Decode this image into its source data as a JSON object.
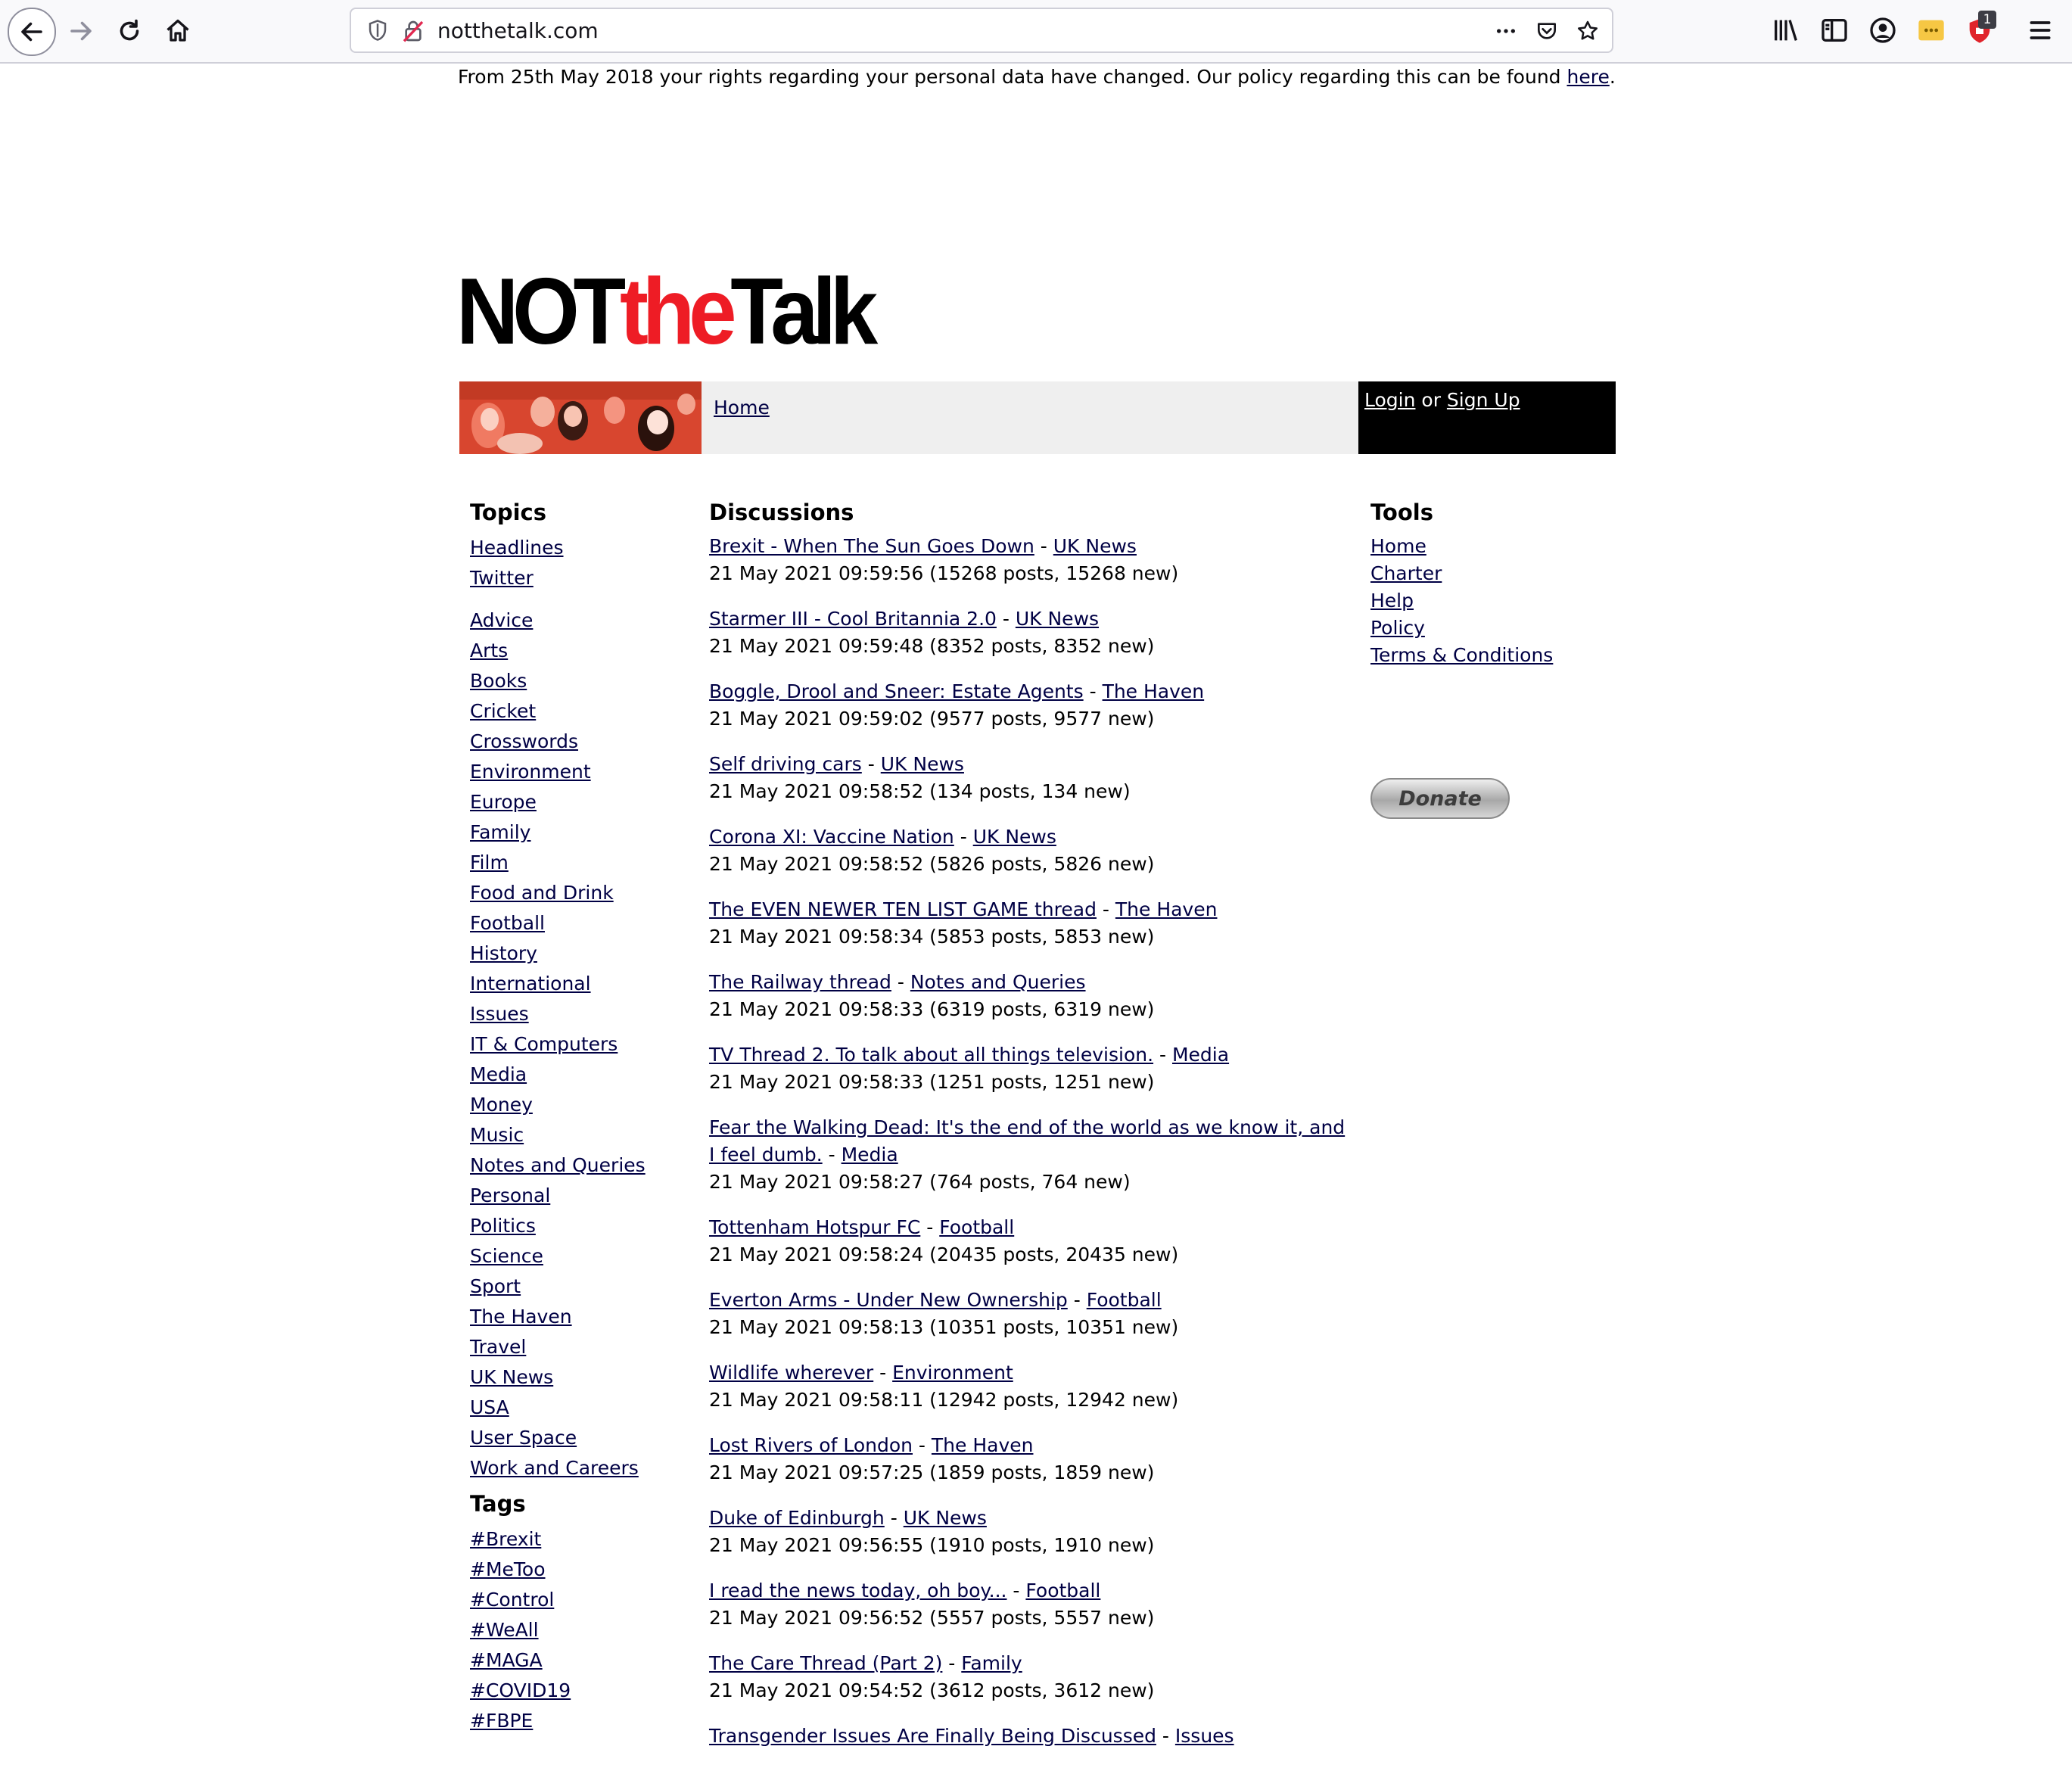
{
  "browser": {
    "url": "notthetalk.com",
    "badge_count": "1"
  },
  "notice": {
    "text": "From 25th May 2018 your rights regarding your personal data have changed. Our policy regarding this can be found ",
    "link": "here",
    "end": "."
  },
  "logo": {
    "part1": "NOT",
    "part2": "the",
    "part3": "Talk"
  },
  "banner": {
    "crumb": "Home"
  },
  "auth": {
    "login": "Login",
    "or": " or ",
    "signup": "Sign Up"
  },
  "topics": {
    "title": "Topics",
    "top": [
      "Headlines",
      "Twitter"
    ],
    "items": [
      "Advice",
      "Arts",
      "Books",
      "Cricket",
      "Crosswords",
      "Environment",
      "Europe",
      "Family",
      "Film",
      "Food and Drink",
      "Football",
      "History",
      "International",
      "Issues",
      "IT & Computers",
      "Media",
      "Money",
      "Music",
      "Notes and Queries",
      "Personal",
      "Politics",
      "Science",
      "Sport",
      "The Haven",
      "Travel",
      "UK News",
      "USA",
      "User Space",
      "Work and Careers"
    ]
  },
  "tags": {
    "title": "Tags",
    "items": [
      "#Brexit",
      "#MeToo",
      "#Control",
      "#WeAll",
      "#MAGA",
      "#COVID19",
      "#FBPE"
    ]
  },
  "discussions": {
    "title": "Discussions",
    "sep": " - ",
    "items": [
      {
        "title": "Brexit - When The Sun Goes Down",
        "topic": "UK News",
        "meta": "21 May 2021 09:59:56 (15268 posts, 15268 new)"
      },
      {
        "title": "Starmer III - Cool Britannia 2.0",
        "topic": "UK News",
        "meta": "21 May 2021 09:59:48 (8352 posts, 8352 new)"
      },
      {
        "title": "Boggle, Drool and Sneer: Estate Agents",
        "topic": "The Haven",
        "meta": "21 May 2021 09:59:02 (9577 posts, 9577 new)"
      },
      {
        "title": "Self driving cars",
        "topic": "UK News",
        "meta": "21 May 2021 09:58:52 (134 posts, 134 new)"
      },
      {
        "title": "Corona XI: Vaccine Nation",
        "topic": "UK News",
        "meta": "21 May 2021 09:58:52 (5826 posts, 5826 new)"
      },
      {
        "title": "The EVEN NEWER TEN LIST GAME thread",
        "topic": "The Haven",
        "meta": "21 May 2021 09:58:34 (5853 posts, 5853 new)"
      },
      {
        "title": "The Railway thread",
        "topic": "Notes and Queries",
        "meta": "21 May 2021 09:58:33 (6319 posts, 6319 new)"
      },
      {
        "title": "TV Thread 2. To talk about all things television.",
        "topic": "Media",
        "meta": "21 May 2021 09:58:33 (1251 posts, 1251 new)"
      },
      {
        "title": "Fear the Walking Dead: It's the end of the world as we know it, and I feel dumb.",
        "topic": "Media",
        "meta": "21 May 2021 09:58:27 (764 posts, 764 new)"
      },
      {
        "title": "Tottenham Hotspur FC",
        "topic": "Football",
        "meta": "21 May 2021 09:58:24 (20435 posts, 20435 new)"
      },
      {
        "title": "Everton Arms - Under New Ownership",
        "topic": "Football",
        "meta": "21 May 2021 09:58:13 (10351 posts, 10351 new)"
      },
      {
        "title": "Wildlife wherever",
        "topic": "Environment",
        "meta": "21 May 2021 09:58:11 (12942 posts, 12942 new)"
      },
      {
        "title": "Lost Rivers of London",
        "topic": "The Haven",
        "meta": "21 May 2021 09:57:25 (1859 posts, 1859 new)"
      },
      {
        "title": "Duke of Edinburgh",
        "topic": "UK News",
        "meta": "21 May 2021 09:56:55 (1910 posts, 1910 new)"
      },
      {
        "title": "I read the news today, oh boy...",
        "topic": "Football",
        "meta": "21 May 2021 09:56:52 (5557 posts, 5557 new)"
      },
      {
        "title": "The Care Thread (Part 2)",
        "topic": "Family",
        "meta": "21 May 2021 09:54:52 (3612 posts, 3612 new)"
      },
      {
        "title": "Transgender Issues Are Finally Being Discussed",
        "topic": "Issues",
        "meta": ""
      }
    ]
  },
  "tools": {
    "title": "Tools",
    "items": [
      "Home",
      "Charter",
      "Help",
      "Policy",
      "Terms & Conditions"
    ],
    "donate": "Donate"
  }
}
